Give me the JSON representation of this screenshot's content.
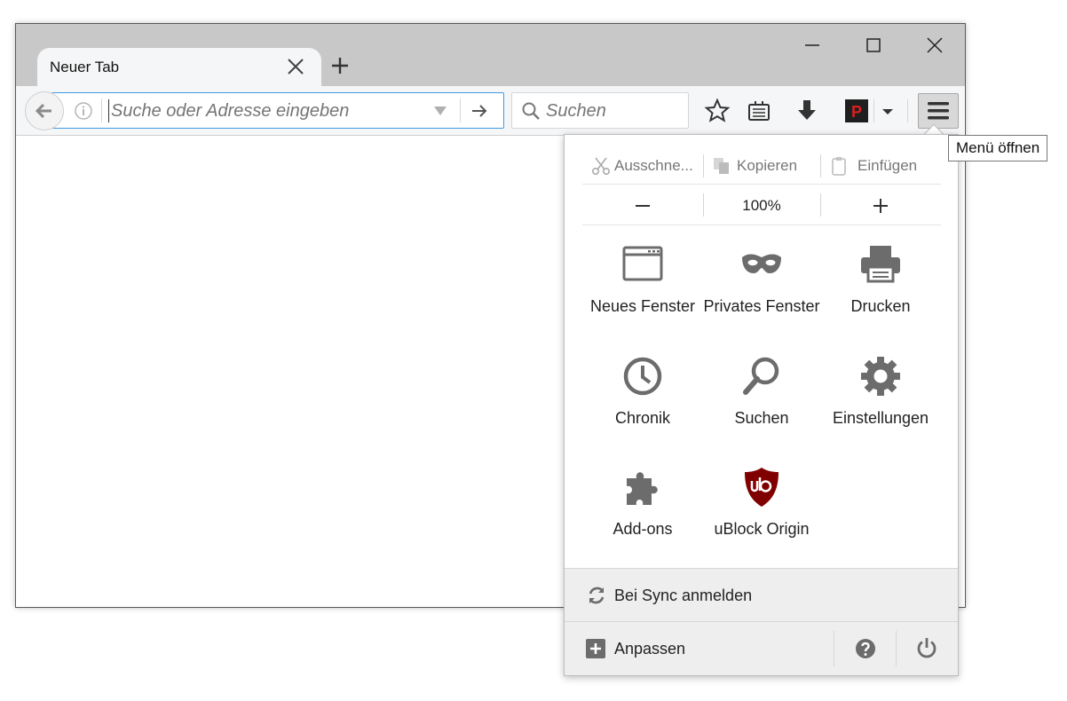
{
  "tab": {
    "title": "Neuer Tab"
  },
  "urlbar": {
    "placeholder": "Suche oder Adresse eingeben"
  },
  "searchbar": {
    "placeholder": "Suchen"
  },
  "tooltip": {
    "text": "Menü öffnen"
  },
  "menu": {
    "edit": {
      "cut": "Ausschne...",
      "copy": "Kopieren",
      "paste": "Einfügen"
    },
    "zoom": {
      "value": "100%"
    },
    "items": [
      {
        "label": "Neues Fenster",
        "icon": "window-icon"
      },
      {
        "label": "Privates Fenster",
        "icon": "mask-icon"
      },
      {
        "label": "Drucken",
        "icon": "printer-icon"
      },
      {
        "label": "Chronik",
        "icon": "clock-icon"
      },
      {
        "label": "Suchen",
        "icon": "magnifier-icon"
      },
      {
        "label": "Einstellungen",
        "icon": "gear-icon"
      },
      {
        "label": "Add-ons",
        "icon": "puzzle-icon"
      },
      {
        "label": "uBlock Origin",
        "icon": "ublock-icon"
      }
    ],
    "sync": "Bei Sync anmelden",
    "customize": "Anpassen"
  },
  "colors": {
    "accent": "#3f9ae4",
    "ublock": "#800000",
    "icon_gray": "#6c6c6c"
  }
}
